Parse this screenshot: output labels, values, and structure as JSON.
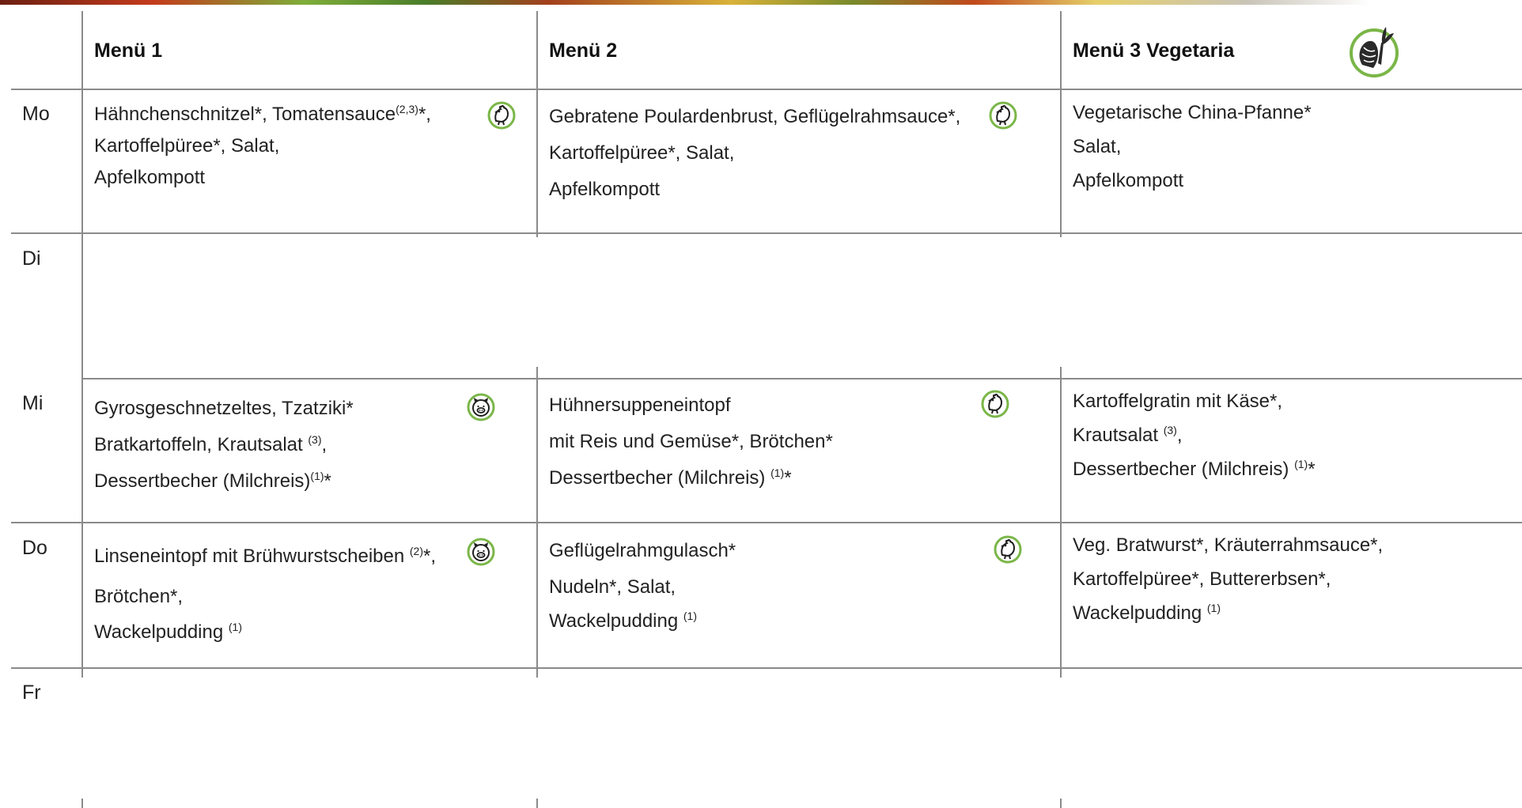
{
  "headers": {
    "menu1": "Menü 1",
    "menu2": "Menü 2",
    "menu3": "Menü 3 Vegetaria"
  },
  "days": [
    "Mo",
    "Di",
    "Mi",
    "Do",
    "Fr"
  ],
  "cells": {
    "mo_1": {
      "l1": "Hähnchenschnitzel*, Tomatensauce",
      "l1_sup": "(2,3)",
      "l1_tail": "*,",
      "l2": "Kartoffelpüree*, Salat,",
      "l3": "Apfelkompott",
      "icon": "chicken-icon"
    },
    "mo_2": {
      "l1": "Gebratene Poulardenbrust, Geflügelrahmsauce*,",
      "l2": "Kartoffelpüree*, Salat,",
      "l3": "Apfelkompott",
      "icon": "chicken-icon"
    },
    "mo_3": {
      "l1": "Vegetarische China-Pfanne*",
      "l2": "Salat,",
      "l3": "Apfelkompott"
    },
    "mi_1": {
      "l1": "Gyrosgeschnetzeltes, Tzatziki*",
      "l2": "Bratkartoffeln, Krautsalat ",
      "l2_sup": "(3)",
      "l2_tail": ",",
      "l3": "Dessertbecher (Milchreis)",
      "l3_sup": "(1)",
      "l3_tail": "*",
      "icon": "pig-icon"
    },
    "mi_2": {
      "l1": "Hühnersuppeneintopf",
      "l2": "mit Reis und Gemüse*, Brötchen*",
      "l3": "Dessertbecher (Milchreis) ",
      "l3_sup": "(1)",
      "l3_tail": "*",
      "icon": "chicken-icon"
    },
    "mi_3": {
      "l1": "Kartoffelgratin mit Käse*,",
      "l2": "Krautsalat ",
      "l2_sup": "(3)",
      "l2_tail": ",",
      "l3": "Dessertbecher (Milchreis) ",
      "l3_sup": "(1)",
      "l3_tail": "*"
    },
    "do_1": {
      "l1": "Linseneintopf mit Brühwurstscheiben ",
      "l1_sup": "(2)",
      "l1_tail": "*,",
      "l2": "Brötchen*,",
      "l3": "Wackelpudding ",
      "l3_sup": "(1)",
      "l3_tail": "",
      "icon": "pig-icon"
    },
    "do_2": {
      "l1": "Geflügelrahmgulasch*",
      "l2": "Nudeln*, Salat,",
      "l3": "Wackelpudding ",
      "l3_sup": "(1)",
      "l3_tail": "",
      "icon": "chicken-icon"
    },
    "do_3": {
      "l1": "Veg. Bratwurst*, Kräuterrahmsauce*,",
      "l2": "Kartoffelpüree*, Buttererbsen*,",
      "l3": "Wackelpudding ",
      "l3_sup": "(1)",
      "l3_tail": ""
    }
  },
  "header_icon": "vegetable-icon",
  "colors": {
    "icon_ring": "#7ab648",
    "grid": "#8a8a8a"
  }
}
